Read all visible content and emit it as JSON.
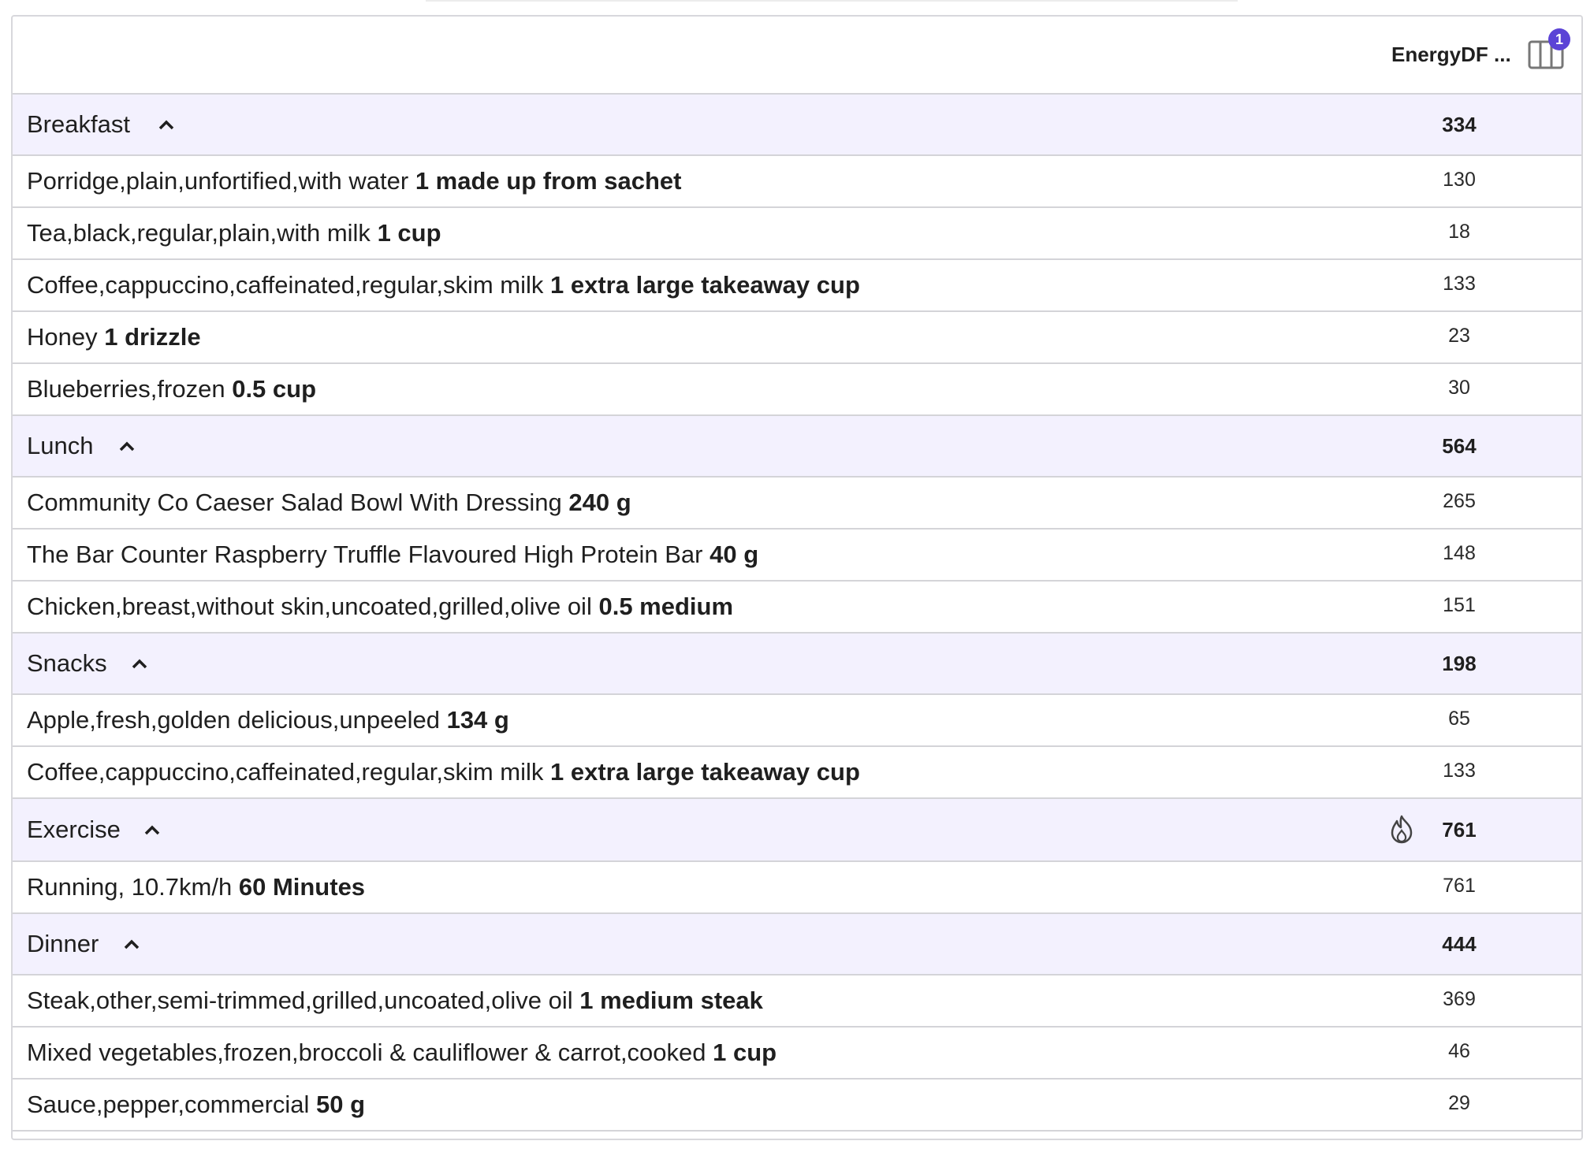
{
  "header": {
    "column_title": "EnergyDF ...",
    "columns_badge": "1"
  },
  "colors": {
    "group_bg": "#f3f1fe",
    "badge": "#5b43d6",
    "border": "#d4d4d8"
  },
  "groups": [
    {
      "name": "Breakfast",
      "total": "334",
      "items": [
        {
          "food": "Porridge,plain,unfortified,with water",
          "amount": "1 made up from sachet",
          "value": "130"
        },
        {
          "food": "Tea,black,regular,plain,with milk",
          "amount": "1 cup",
          "value": "18"
        },
        {
          "food": "Coffee,cappuccino,caffeinated,regular,skim milk",
          "amount": "1 extra large takeaway cup",
          "value": "133"
        },
        {
          "food": "Honey",
          "amount": "1 drizzle",
          "value": "23"
        },
        {
          "food": "Blueberries,frozen",
          "amount": "0.5 cup",
          "value": "30"
        }
      ]
    },
    {
      "name": "Lunch",
      "total": "564",
      "items": [
        {
          "food": "Community Co Caeser Salad Bowl With Dressing",
          "amount": "240 g",
          "value": "265"
        },
        {
          "food": "The Bar Counter Raspberry Truffle Flavoured High Protein Bar",
          "amount": "40 g",
          "value": "148"
        },
        {
          "food": "Chicken,breast,without skin,uncoated,grilled,olive oil",
          "amount": "0.5 medium",
          "value": "151"
        }
      ]
    },
    {
      "name": "Snacks",
      "total": "198",
      "items": [
        {
          "food": "Apple,fresh,golden delicious,unpeeled",
          "amount": "134 g",
          "value": "65"
        },
        {
          "food": "Coffee,cappuccino,caffeinated,regular,skim milk",
          "amount": "1 extra large takeaway cup",
          "value": "133"
        }
      ]
    },
    {
      "name": "Exercise",
      "total": "761",
      "icon": "flame-icon",
      "items": [
        {
          "food": "Running, 10.7km/h",
          "amount": "60 Minutes",
          "value": "761"
        }
      ]
    },
    {
      "name": "Dinner",
      "total": "444",
      "items": [
        {
          "food": "Steak,other,semi-trimmed,grilled,uncoated,olive oil",
          "amount": "1 medium steak",
          "value": "369"
        },
        {
          "food": "Mixed vegetables,frozen,broccoli & cauliflower & carrot,cooked",
          "amount": "1 cup",
          "value": "46"
        },
        {
          "food": "Sauce,pepper,commercial",
          "amount": "50 g",
          "value": "29"
        }
      ]
    }
  ]
}
